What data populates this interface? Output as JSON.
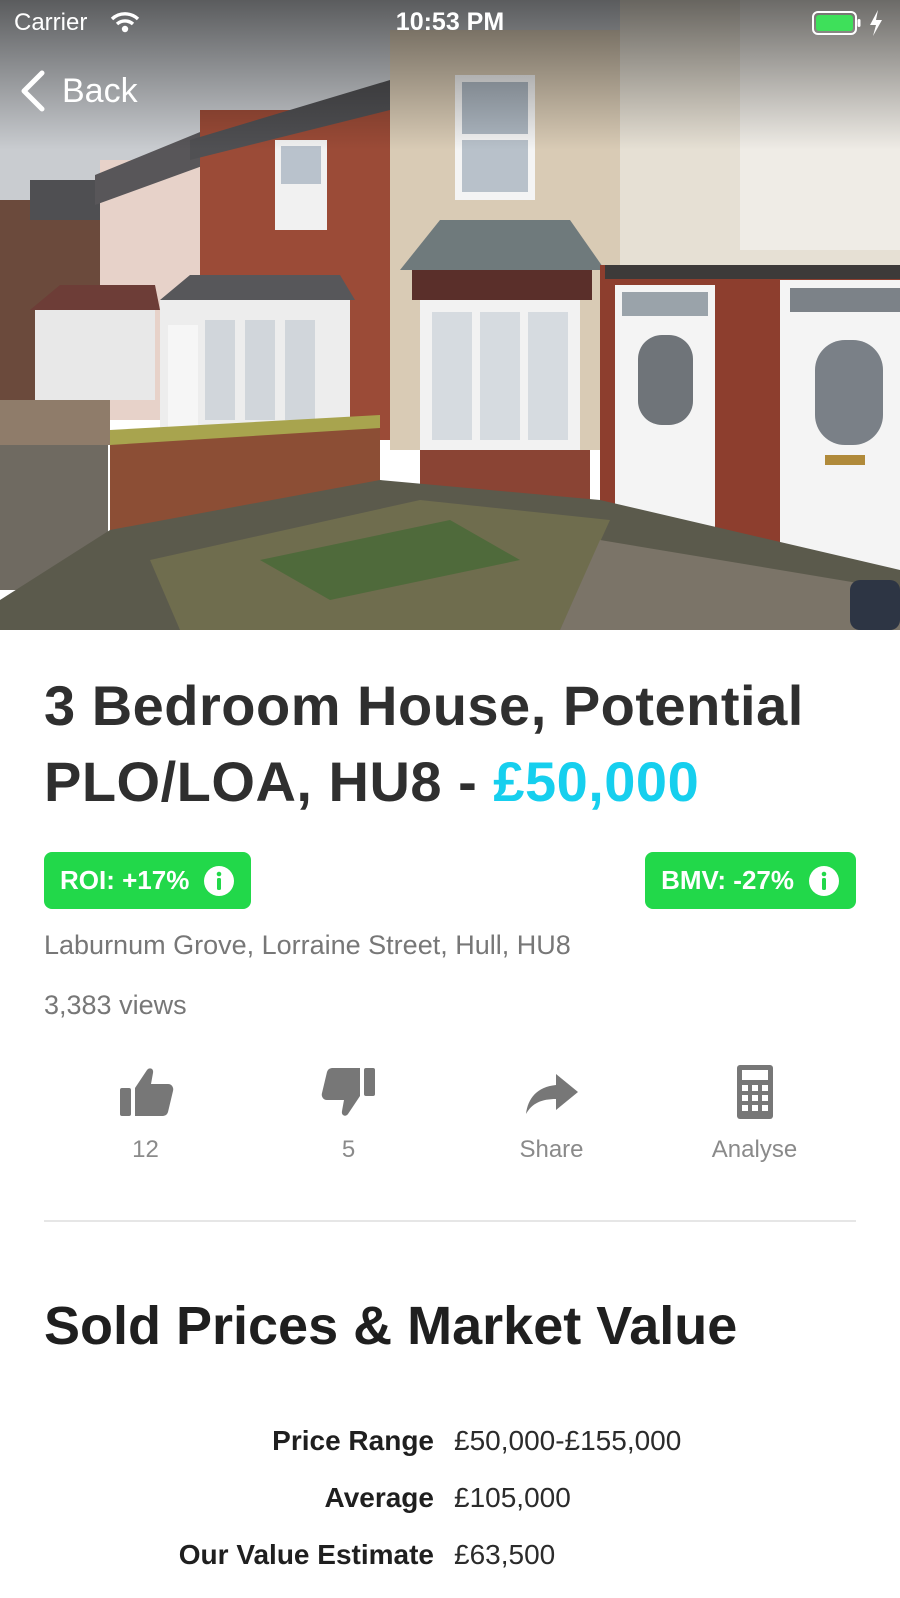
{
  "status_bar": {
    "carrier": "Carrier",
    "time": "10:53 PM"
  },
  "nav": {
    "back_label": "Back"
  },
  "listing": {
    "title": "3 Bedroom House, Potential PLO/LOA, HU8 - ",
    "price": "£50,000",
    "roi_badge": "ROI: +17%",
    "bmv_badge": "BMV: -27%",
    "address": "Laburnum Grove, Lorraine Street, Hull, HU8",
    "views": "3,383 views"
  },
  "actions": [
    {
      "icon": "thumbs-up-icon",
      "label": "12"
    },
    {
      "icon": "thumbs-down-icon",
      "label": "5"
    },
    {
      "icon": "share-icon",
      "label": "Share"
    },
    {
      "icon": "calculator-icon",
      "label": "Analyse"
    }
  ],
  "sold_prices": {
    "heading": "Sold Prices & Market Value",
    "rows": [
      {
        "key": "Price Range",
        "value": "£50,000-£155,000"
      },
      {
        "key": "Average",
        "value": "£105,000"
      },
      {
        "key": "Our Value Estimate",
        "value": "£63,500"
      }
    ]
  },
  "colors": {
    "accent_price": "#16cfee",
    "badge_green": "#22d84a",
    "muted_text": "#777777"
  }
}
